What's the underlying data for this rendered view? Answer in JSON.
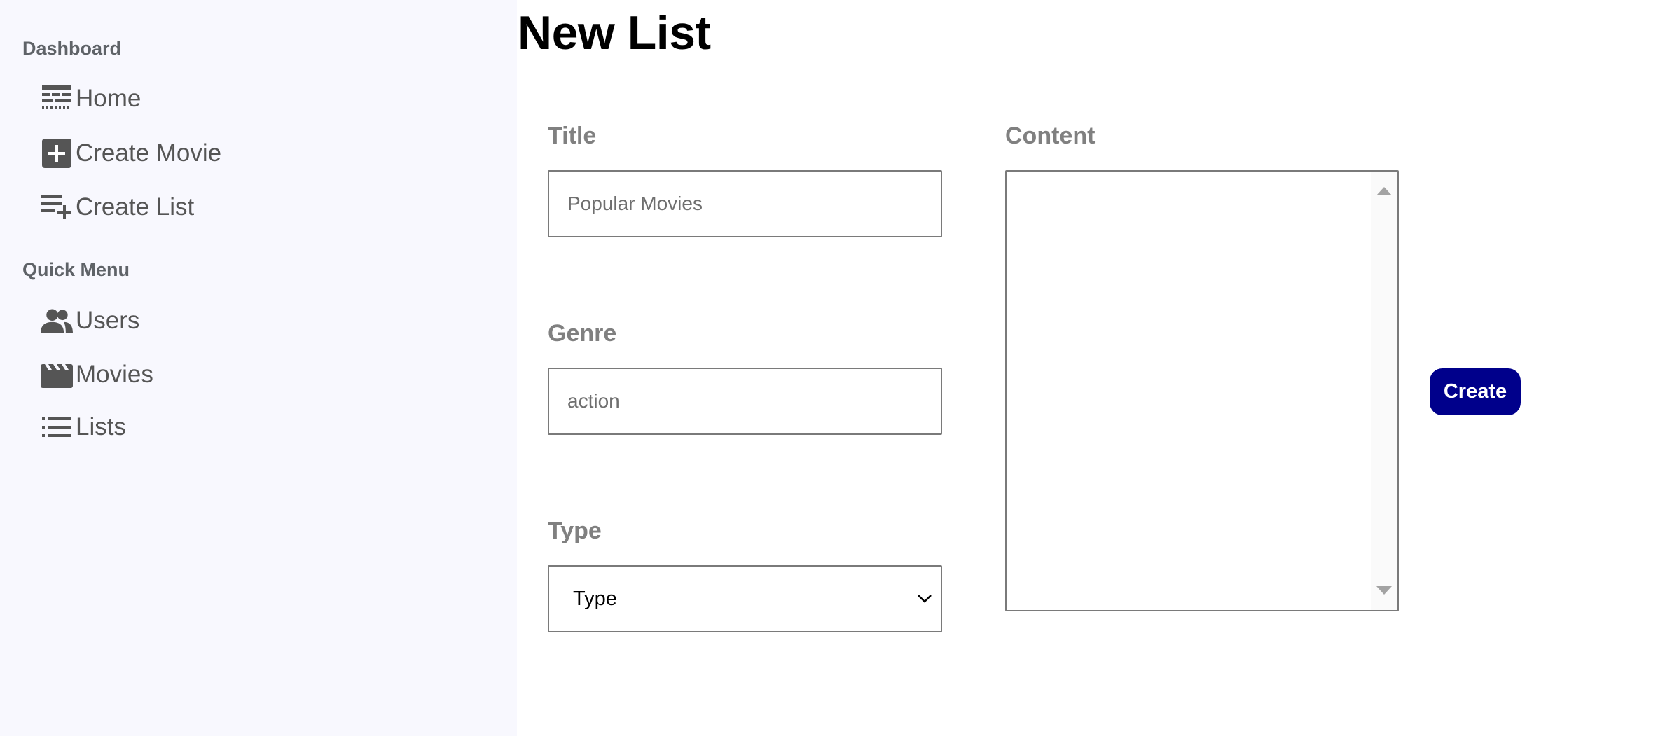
{
  "sidebar": {
    "sections": [
      {
        "title": "Dashboard",
        "items": [
          {
            "label": "Home",
            "icon": "home-icon"
          },
          {
            "label": "Create Movie",
            "icon": "add-box-icon"
          },
          {
            "label": "Create List",
            "icon": "playlist-add-icon"
          }
        ]
      },
      {
        "title": "Quick Menu",
        "items": [
          {
            "label": "Users",
            "icon": "users-icon"
          },
          {
            "label": "Movies",
            "icon": "movie-icon"
          },
          {
            "label": "Lists",
            "icon": "list-icon"
          }
        ]
      }
    ]
  },
  "main": {
    "title": "New List",
    "form": {
      "title_label": "Title",
      "title_placeholder": "Popular Movies",
      "genre_label": "Genre",
      "genre_placeholder": "action",
      "type_label": "Type",
      "type_value": "Type",
      "content_label": "Content",
      "submit_label": "Create"
    }
  },
  "colors": {
    "sidebar_bg": "#f8f8fe",
    "accent": "#00008b",
    "label_gray": "#808080"
  }
}
